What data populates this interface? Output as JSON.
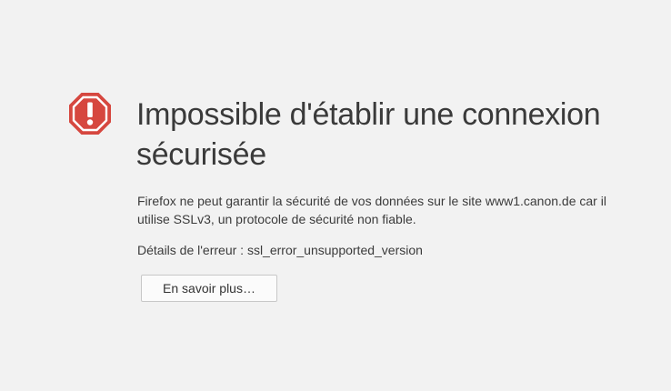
{
  "error": {
    "icon": "warning-octagon-icon",
    "icon_color": "#d6473f",
    "title": "Impossible d'établir une connexion sécurisée",
    "description": "Firefox ne peut garantir la sécurité de vos données sur le site www1.canon.de car il utilise SSLv3, un protocole de sécurité non fiable.",
    "details": "Détails de l'erreur : ssl_error_unsupported_version",
    "learn_more_label": "En savoir plus…"
  }
}
